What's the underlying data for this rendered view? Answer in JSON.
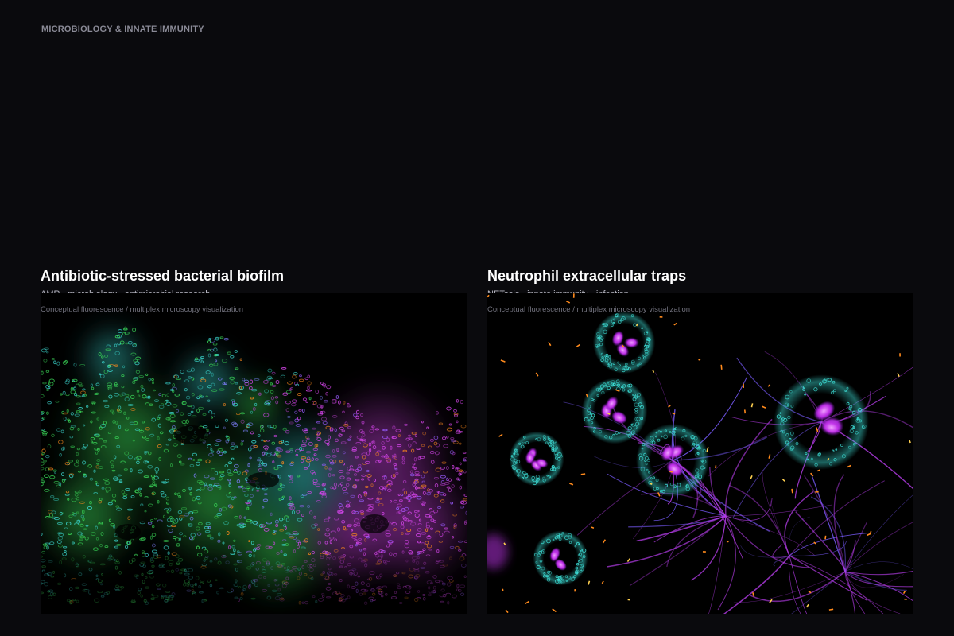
{
  "page": {
    "section_label": "MICROBIOLOGY & INNATE IMMUNITY"
  },
  "cards": [
    {
      "title": "Antibiotic-stressed bacterial biofilm",
      "tags": "AMR · microbiology · antimicrobial research",
      "caption": "Conceptual fluorescence / multiplex microscopy visualization"
    },
    {
      "title": "Neutrophil extracellular traps",
      "tags": "NETosis · innate immunity · infection",
      "caption": "Conceptual fluorescence / multiplex microscopy visualization"
    }
  ],
  "colors": {
    "background": "#0a0a0d",
    "green": "#3cdc5a",
    "cyan": "#3ee0d8",
    "magenta": "#d946ef",
    "orange": "#ff8a1c"
  }
}
